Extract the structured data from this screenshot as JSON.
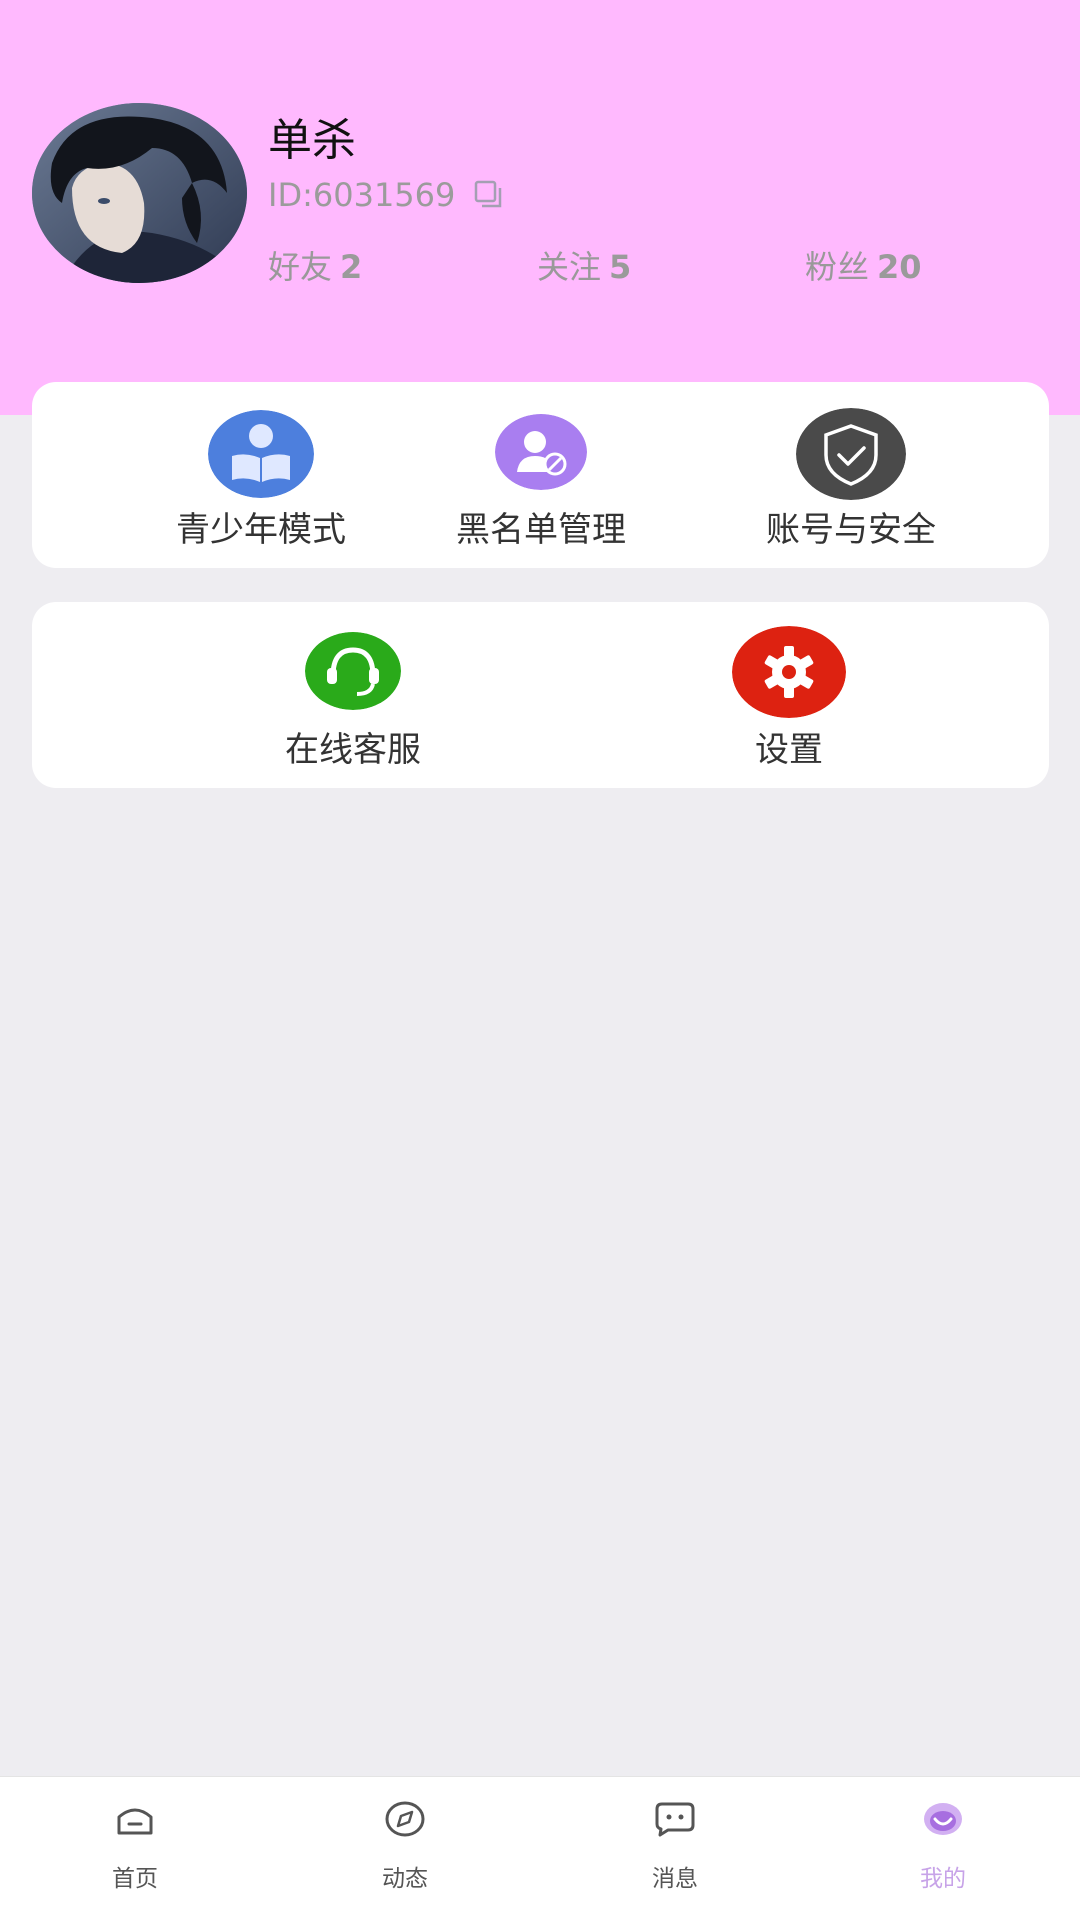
{
  "profile": {
    "name": "单杀",
    "id_text": "ID:6031569",
    "stats": [
      {
        "label": "好友",
        "value": "2"
      },
      {
        "label": "关注",
        "value": "5"
      },
      {
        "label": "粉丝",
        "value": "20"
      }
    ]
  },
  "menu_card1": [
    {
      "label": "青少年模式",
      "icon": "teen-mode-icon",
      "color": "#4d7fdd"
    },
    {
      "label": "黑名单管理",
      "icon": "blacklist-icon",
      "color": "#a97ef0"
    },
    {
      "label": "账号与安全",
      "icon": "shield-check-icon",
      "color": "#4a4a4a"
    }
  ],
  "menu_card2": [
    {
      "label": "在线客服",
      "icon": "headset-icon",
      "color": "#2aaa1a"
    },
    {
      "label": "设置",
      "icon": "gear-icon",
      "color": "#dd2211"
    }
  ],
  "tabs": [
    {
      "label": "首页",
      "icon": "home-icon",
      "active": false
    },
    {
      "label": "动态",
      "icon": "compass-icon",
      "active": false
    },
    {
      "label": "消息",
      "icon": "message-icon",
      "active": false
    },
    {
      "label": "我的",
      "icon": "profile-icon",
      "active": true
    }
  ],
  "colors": {
    "header_bg": "#ffb9fe",
    "page_bg": "#eeedf1",
    "active_tab": "#c7a3e8"
  }
}
